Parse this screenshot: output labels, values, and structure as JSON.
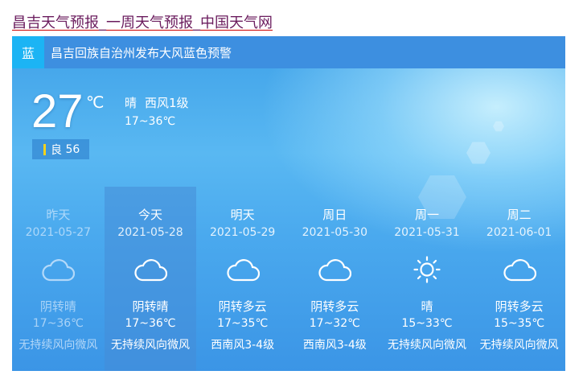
{
  "page_link": "昌吉天气预报_一周天气预报_中国天气网",
  "alert": {
    "badge": "蓝",
    "text": "昌吉回族自治州发布大风蓝色预警"
  },
  "current": {
    "temp": "27",
    "unit": "℃",
    "weather": "晴",
    "wind": "西风1级",
    "range": "17~36℃",
    "aqi_label": "良",
    "aqi_value": "56",
    "aqi_color": "#f4d21c"
  },
  "forecast": [
    {
      "name": "昨天",
      "date": "2021-05-27",
      "icon": "cloud-icon",
      "cond": "阴转晴",
      "temp": "17~36℃",
      "wind": "无持续风向微风"
    },
    {
      "name": "今天",
      "date": "2021-05-28",
      "icon": "cloud-icon",
      "cond": "阴转晴",
      "temp": "17~36℃",
      "wind": "无持续风向微风"
    },
    {
      "name": "明天",
      "date": "2021-05-29",
      "icon": "cloud-icon",
      "cond": "阴转多云",
      "temp": "17~35℃",
      "wind": "西南风3-4级"
    },
    {
      "name": "周日",
      "date": "2021-05-30",
      "icon": "cloud-icon",
      "cond": "阴转多云",
      "temp": "17~32℃",
      "wind": "西南风3-4级"
    },
    {
      "name": "周一",
      "date": "2021-05-31",
      "icon": "sun-icon",
      "cond": "晴",
      "temp": "15~33℃",
      "wind": "无持续风向微风"
    },
    {
      "name": "周二",
      "date": "2021-06-01",
      "icon": "cloud-icon",
      "cond": "阴转多云",
      "temp": "15~35℃",
      "wind": "无持续风向微风"
    }
  ]
}
